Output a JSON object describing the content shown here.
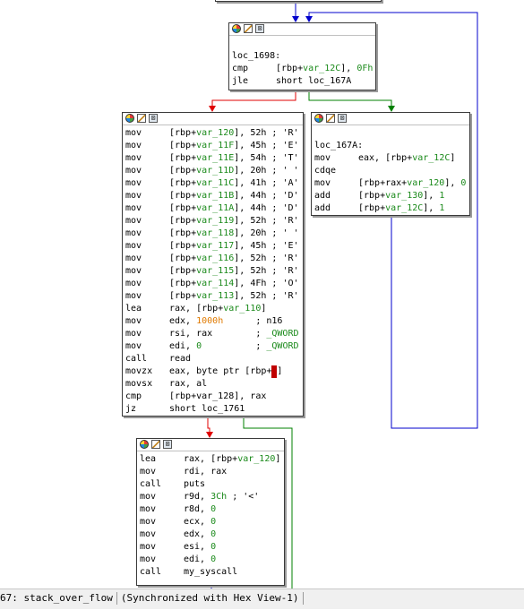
{
  "top_block": {
    "label": "loc_1698:",
    "lines": [
      {
        "mn": "cmp",
        "a": "[rbp+",
        "b": "var_12C",
        "c": "], ",
        "d": "0Fh"
      },
      {
        "mn": "jle",
        "a": "short loc_167A",
        "b": "",
        "c": "",
        "d": ""
      }
    ]
  },
  "left_block": {
    "lines": [
      {
        "mn": "mov",
        "a": "[rbp+",
        "b": "var_120",
        "c": "], 52h ; 'R'"
      },
      {
        "mn": "mov",
        "a": "[rbp+",
        "b": "var_11F",
        "c": "], 45h ; 'E'"
      },
      {
        "mn": "mov",
        "a": "[rbp+",
        "b": "var_11E",
        "c": "], 54h ; 'T'"
      },
      {
        "mn": "mov",
        "a": "[rbp+",
        "b": "var_11D",
        "c": "], 20h ; ' '"
      },
      {
        "mn": "mov",
        "a": "[rbp+",
        "b": "var_11C",
        "c": "], 41h ; 'A'"
      },
      {
        "mn": "mov",
        "a": "[rbp+",
        "b": "var_11B",
        "c": "], 44h ; 'D'"
      },
      {
        "mn": "mov",
        "a": "[rbp+",
        "b": "var_11A",
        "c": "], 44h ; 'D'"
      },
      {
        "mn": "mov",
        "a": "[rbp+",
        "b": "var_119",
        "c": "], 52h ; 'R'"
      },
      {
        "mn": "mov",
        "a": "[rbp+",
        "b": "var_118",
        "c": "], 20h ; ' '"
      },
      {
        "mn": "mov",
        "a": "[rbp+",
        "b": "var_117",
        "c": "], 45h ; 'E'"
      },
      {
        "mn": "mov",
        "a": "[rbp+",
        "b": "var_116",
        "c": "], 52h ; 'R'"
      },
      {
        "mn": "mov",
        "a": "[rbp+",
        "b": "var_115",
        "c": "], 52h ; 'R'"
      },
      {
        "mn": "mov",
        "a": "[rbp+",
        "b": "var_114",
        "c": "], 4Fh ; 'O'"
      },
      {
        "mn": "mov",
        "a": "[rbp+",
        "b": "var_113",
        "c": "], 52h ; 'R'"
      },
      {
        "mn": "lea",
        "a": "rax, [rbp+",
        "b": "var_110",
        "c": "]"
      },
      {
        "mn": "mov",
        "a": "edx, ",
        "o": "1000h",
        "c": "      ; n16"
      },
      {
        "mn": "mov",
        "a": "rsi, rax        ; ",
        "b": "_QWORD"
      },
      {
        "mn": "mov",
        "a": "edi, ",
        "b": "0",
        "c": "          ; ",
        "b2": "_QWORD"
      },
      {
        "mn": "call",
        "a": "read"
      },
      {
        "mn": "movzx",
        "a": "eax, byte ptr [rbp+",
        "hl": "8",
        "c": "]"
      },
      {
        "mn": "movsx",
        "a": "rax, al"
      },
      {
        "mn": "cmp",
        "a": "[rbp+var_128], rax"
      },
      {
        "mn": "jz",
        "a": "short loc_1761"
      }
    ]
  },
  "right_block": {
    "label": "loc_167A:",
    "lines": [
      {
        "mn": "mov",
        "a": "eax, [rbp+",
        "b": "var_12C",
        "c": "]"
      },
      {
        "mn": "cdqe",
        "a": ""
      },
      {
        "mn": "mov",
        "a": "[rbp+rax+",
        "b": "var_120",
        "c": "], ",
        "b2": "0"
      },
      {
        "mn": "add",
        "a": "[rbp+",
        "b": "var_130",
        "c": "], ",
        "b2": "1"
      },
      {
        "mn": "add",
        "a": "[rbp+",
        "b": "var_12C",
        "c": "], ",
        "b2": "1"
      }
    ]
  },
  "bottom_block": {
    "lines": [
      {
        "mn": "lea",
        "a": "rax, [rbp+",
        "b": "var_120",
        "c": "]"
      },
      {
        "mn": "mov",
        "a": "rdi, rax"
      },
      {
        "mn": "call",
        "a": "puts"
      },
      {
        "mn": "mov",
        "a": "r9d, ",
        "b": "3Ch",
        "c": " ; '<'"
      },
      {
        "mn": "mov",
        "a": "r8d, ",
        "b": "0"
      },
      {
        "mn": "mov",
        "a": "ecx, ",
        "b": "0"
      },
      {
        "mn": "mov",
        "a": "edx, ",
        "b": "0"
      },
      {
        "mn": "mov",
        "a": "esi, ",
        "b": "0"
      },
      {
        "mn": "mov",
        "a": "edi, ",
        "b": "0"
      },
      {
        "mn": "call",
        "a": "my_syscall"
      }
    ]
  },
  "statusbar": {
    "left": "67: stack_over_flow",
    "right": "(Synchronized with Hex View-1)"
  },
  "colors": {
    "true_edge": "#008000",
    "false_edge": "#e00000",
    "loop_edge": "#0000cc",
    "operand_green": "#1b8a1b",
    "immediate_orange": "#e07a00"
  }
}
